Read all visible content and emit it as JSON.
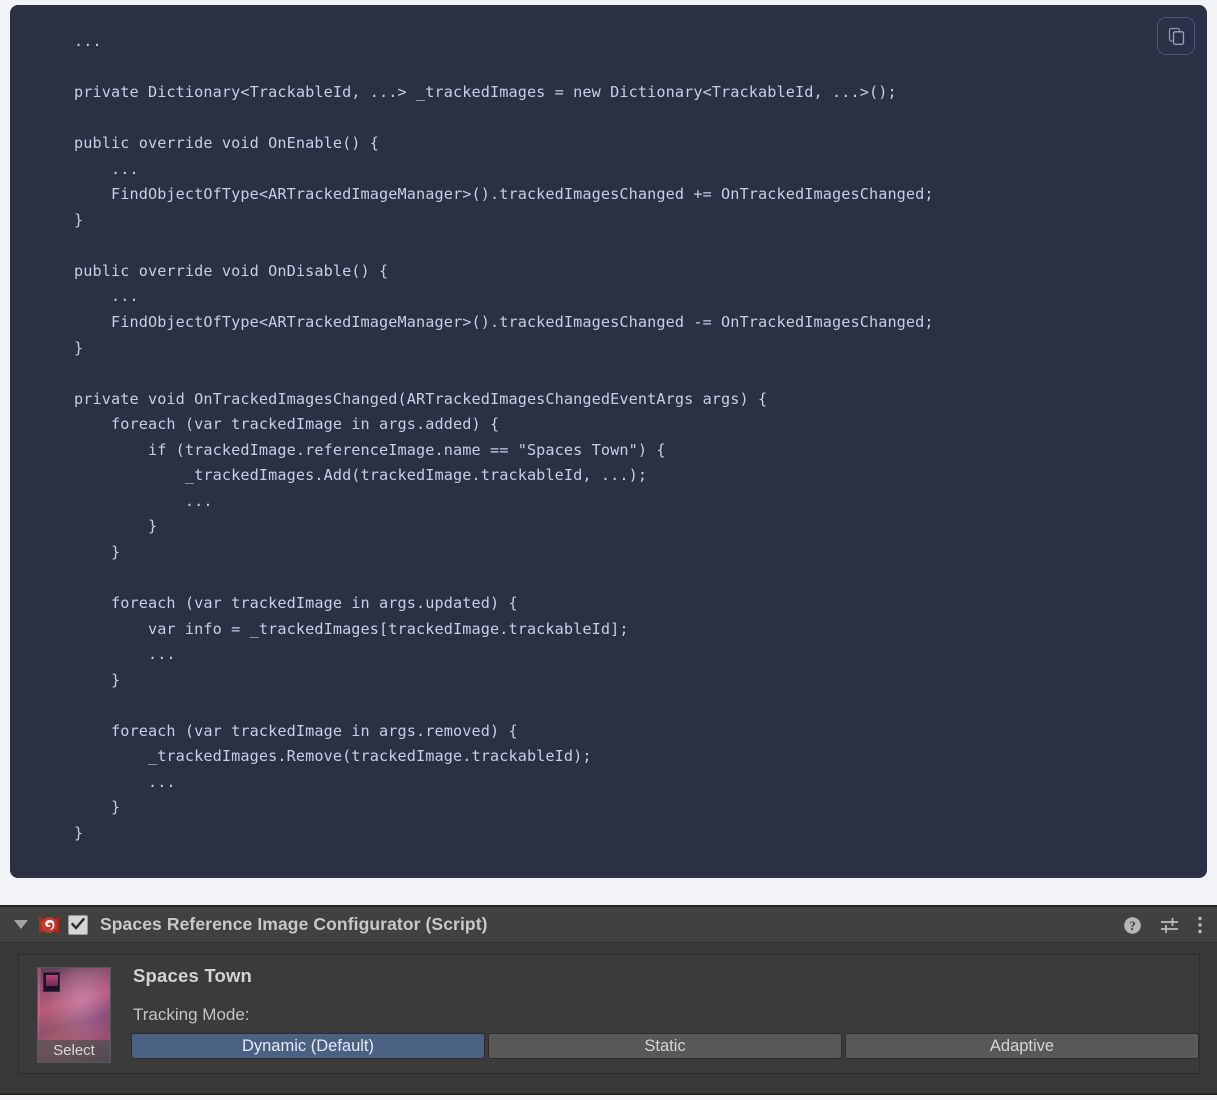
{
  "code_block": {
    "copy_button_label": "copy-code",
    "language": "csharp",
    "code": "...\n\nprivate Dictionary<TrackableId, ...> _trackedImages = new Dictionary<TrackableId, ...>();\n\npublic override void OnEnable() {\n    ...\n    FindObjectOfType<ARTrackedImageManager>().trackedImagesChanged += OnTrackedImagesChanged;\n}\n\npublic override void OnDisable() {\n    ...\n    FindObjectOfType<ARTrackedImageManager>().trackedImagesChanged -= OnTrackedImagesChanged;\n}\n\nprivate void OnTrackedImagesChanged(ARTrackedImagesChangedEventArgs args) {\n    foreach (var trackedImage in args.added) {\n        if (trackedImage.referenceImage.name == \"Spaces Town\") {\n            _trackedImages.Add(trackedImage.trackableId, ...);\n            ...\n        }\n    }\n\n    foreach (var trackedImage in args.updated) {\n        var info = _trackedImages[trackedImage.trackableId];\n        ...\n    }\n\n    foreach (var trackedImage in args.removed) {\n        _trackedImages.Remove(trackedImage.trackableId);\n        ...\n    }\n}"
  },
  "inspector": {
    "header": {
      "foldout_state": "expanded",
      "component_enabled": true,
      "title": "Spaces Reference Image Configurator (Script)",
      "icons": [
        "help-icon",
        "preset-icon",
        "more-options-icon"
      ]
    },
    "thumbnail": {
      "select_label": "Select"
    },
    "reference_image_name": "Spaces Town",
    "tracking_mode": {
      "label": "Tracking Mode:",
      "selected": "Dynamic (Default)",
      "options": [
        "Dynamic (Default)",
        "Static",
        "Adaptive"
      ]
    }
  },
  "colors": {
    "page_background": "#f2f3f7",
    "code_background": "#2b3045",
    "code_text": "#c7cde2",
    "inspector_body": "#383838",
    "inspector_header": "#414141",
    "segment_selected": "#4a6184",
    "segment_unselected": "#585858",
    "script_icon": "#c0392b"
  }
}
